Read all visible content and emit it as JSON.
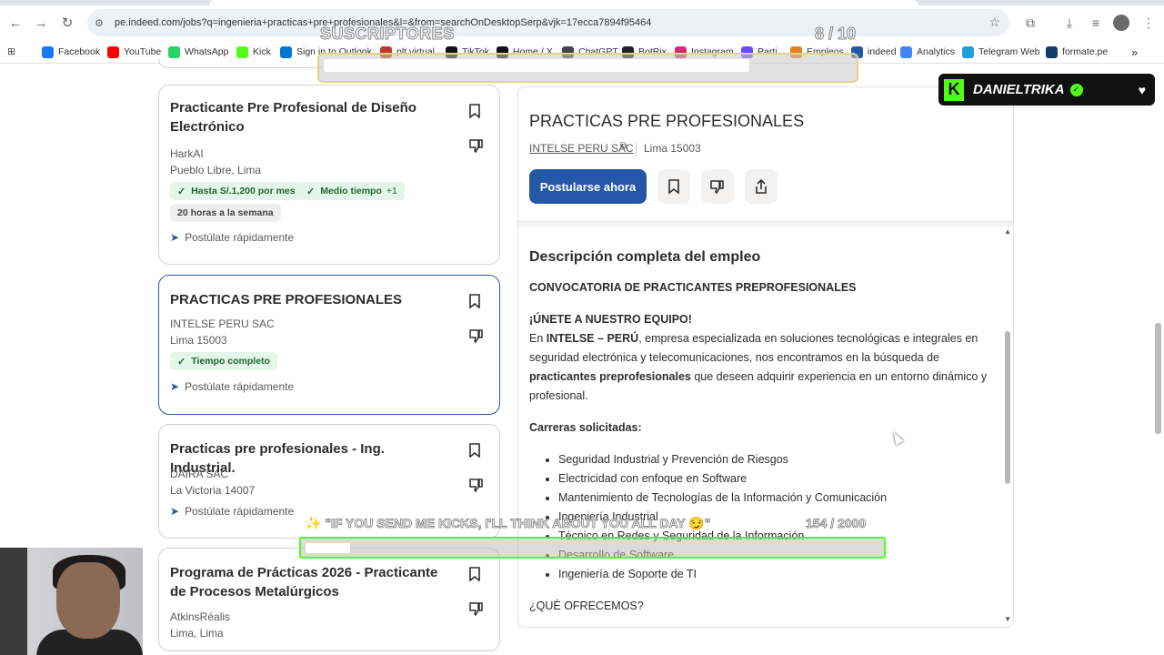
{
  "browser": {
    "url": "pe.indeed.com/jobs?q=ingenieria+practicas+pre+profesionales&l=&from=searchOnDesktopSerp&vjk=17ecca7894f95464",
    "nav": {
      "back": "←",
      "forward": "→",
      "reload": "↻"
    },
    "bookmarks": [
      {
        "label": "Facebook",
        "icon": "facebook-icon",
        "color": "#1877f2"
      },
      {
        "label": "YouTube",
        "icon": "youtube-icon",
        "color": "#ff0000"
      },
      {
        "label": "WhatsApp",
        "icon": "whatsapp-icon",
        "color": "#25d366"
      },
      {
        "label": "Kick",
        "icon": "kick-icon",
        "color": "#53fc18"
      },
      {
        "label": "Sign in to Outlook",
        "icon": "outlook-icon",
        "color": "#0078d4"
      },
      {
        "label": "plt virtual",
        "icon": "plt-icon",
        "color": "#c0392b"
      },
      {
        "label": "TikTok",
        "icon": "tiktok-icon",
        "color": "#111111"
      },
      {
        "label": "Home / X",
        "icon": "x-icon",
        "color": "#111111"
      },
      {
        "label": "ChatGPT",
        "icon": "chatgpt-icon",
        "color": "#444444"
      },
      {
        "label": "BotRix",
        "icon": "botrix-icon",
        "color": "#222222"
      },
      {
        "label": "Instagram",
        "icon": "instagram-icon",
        "color": "#d62976"
      },
      {
        "label": "Parti",
        "icon": "parti-icon",
        "color": "#6a4cff"
      },
      {
        "label": "Empleos",
        "icon": "empleos-icon",
        "color": "#e67e22"
      },
      {
        "label": "indeed",
        "icon": "indeed-icon",
        "color": "#2557a7"
      },
      {
        "label": "Analytics",
        "icon": "analytics-icon",
        "color": "#4285f4"
      },
      {
        "label": "Telegram Web",
        "icon": "telegram-icon",
        "color": "#229ed9"
      },
      {
        "label": "formate.pe",
        "icon": "formate-icon",
        "color": "#123a6b"
      }
    ]
  },
  "jobs": [
    {
      "title": "Practicante Pre Profesional de Diseño Electrónico",
      "company": "HarkAI",
      "location": "Pueblo Libre, Lima",
      "tags": [
        "Hasta S/.1,200 por mes",
        "Medio tiempo"
      ],
      "tag_more": "+1",
      "gray_tag": "20 horas a la semana",
      "quick_apply": "Postúlate rápidamente"
    },
    {
      "title": "PRACTICAS PRE PROFESIONALES",
      "company": "INTELSE PERU SAC",
      "location": "Lima 15003",
      "tags": [
        "Tiempo completo"
      ],
      "quick_apply": "Postúlate rápidamente"
    },
    {
      "title": "Practicas pre profesionales - Ing. Industrial.",
      "company": "DAIRA SAC",
      "location": "La Victoria 14007",
      "quick_apply": "Postúlate rápidamente"
    },
    {
      "title": "Programa de Prácticas 2026 - Practicante de Procesos Metalúrgicos",
      "company": "AtkinsRéalis",
      "location": "Lima, Lima"
    }
  ],
  "detail": {
    "title": "PRACTICAS PRE PROFESIONALES",
    "company": "INTELSE PERU SAC",
    "location": "Lima 15003",
    "apply_label": "Postularse ahora",
    "heading": "Descripción completa del empleo",
    "convocatoria": "CONVOCATORIA DE PRACTICANTES PREPROFESIONALES",
    "join": "¡ÚNETE A NUESTRO EQUIPO!",
    "intro_1": "En ",
    "intro_company": "INTELSE – PERÚ",
    "intro_2": ", empresa especializada en soluciones tecnológicas e integrales en seguridad electrónica y telecomunicaciones, nos encontramos en la búsqueda de ",
    "intro_bold": "practicantes preprofesionales",
    "intro_3": " que deseen adquirir experiencia en un entorno dinámico y profesional.",
    "careers_heading": "Carreras solicitadas:",
    "careers": [
      "Seguridad Industrial y Prevención de Riesgos",
      "Electricidad con enfoque en Software",
      "Mantenimiento de Tecnologías de la Información y Comunicación",
      "Ingeniería Industrial",
      "Técnico en Redes y Seguridad de la Información",
      "Desarrollo de Software",
      "Ingeniería de Soporte de TI"
    ],
    "offer_heading": "¿QUÉ OFRECEMOS?"
  },
  "overlay": {
    "subs_label": "SUSCRIPTORES",
    "subs_count": "8 / 10",
    "subs_progress": 0.8,
    "goal_text": "✨ \"IF YOU SEND ME KICKS, I'LL THINK ABOUT YOU ALL DAY 😏\"",
    "goal_count": "154 / 2000",
    "goal_progress": 0.077,
    "streamer": "DANIELTRIKA",
    "accent": "#53fc18"
  }
}
